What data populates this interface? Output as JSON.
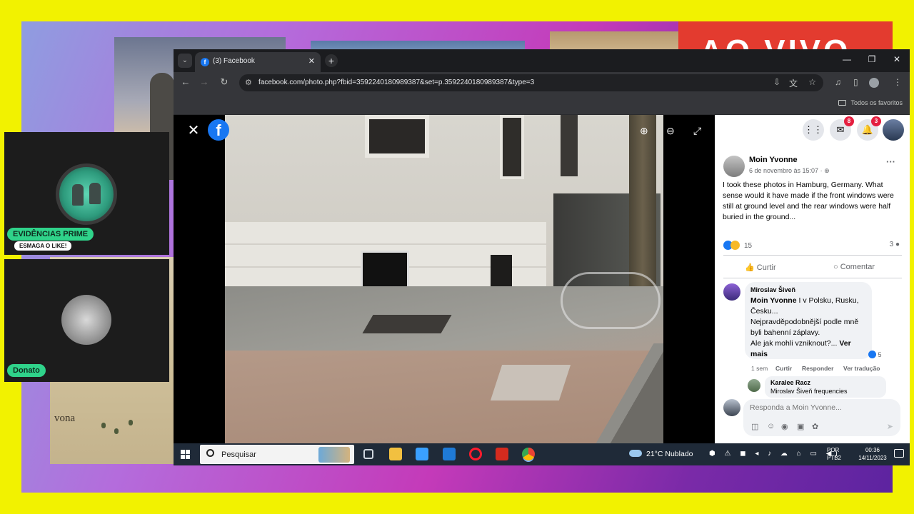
{
  "background": {
    "live_banner": "AO VIVO",
    "map_label": "vona"
  },
  "stream_cards": [
    {
      "name": "EVIDÊNCIAS PRIME",
      "sub": "ESMAGA O LIKE!"
    },
    {
      "name": "Donato",
      "sub": ""
    }
  ],
  "browser": {
    "tab_favicon": "f",
    "tab_title": "(3) Facebook",
    "tab_close": "✕",
    "new_tab": "+",
    "window_controls": [
      "—",
      "❐",
      "✕"
    ],
    "url": "facebook.com/photo.php?fbid=3592240180989387&set=p.3592240180989387&type=3",
    "bookmarks_all": "Todos os favoritos",
    "icons": {
      "back": "←",
      "forward": "→",
      "reload": "↻",
      "site_info": "⚙",
      "install": "⇩",
      "translate": "文",
      "star": "☆",
      "media": "♫",
      "sidepanel": "▯",
      "menu": "⋮",
      "tab_list": "⌄"
    }
  },
  "viewer": {
    "close": "✕",
    "logo": "f",
    "zoom_in": "⊕",
    "zoom_out": "⊖",
    "fullscreen": "⤢"
  },
  "facebook": {
    "top_icons": {
      "apps": "⋮⋮",
      "messenger": "✉",
      "notifications": "🔔"
    },
    "badges": {
      "messenger": "8",
      "notifications": "3"
    },
    "post": {
      "author": "Moin Yvonne",
      "time": "6 de novembro às 15:07 · ⊕",
      "more": "···",
      "text": "I took these photos in Hamburg, Germany. What sense would it have made if the front windows were still at ground level and the rear windows were half buried in the ground...",
      "reaction_count": "15",
      "comment_count": "3",
      "comment_icon": "●",
      "like_label": "Curtir",
      "comment_label": "Comentar",
      "like_icon": "👍",
      "comment_action_icon": "○"
    },
    "comment_1": {
      "author": "Miroslav Šiveň",
      "mention": "Moin Yvonne",
      "text": " I v Polsku, Rusku, Česku...\nNejpravděpodobnější podle mně byli bahenní záplavy.\nAle jak mohli vzniknout?... ",
      "more": "Ver mais",
      "likes": "5",
      "time": "1 sem",
      "like": "Curtir",
      "reply": "Responder",
      "translate": "Ver tradução"
    },
    "comment_2": {
      "author": "Karalee Racz",
      "text": "Miroslav Šiveň frequencies"
    },
    "reply_placeholder": "Responda a Moin Yvonne...",
    "reply_icons": [
      "◫",
      "☺",
      "◉",
      "▣",
      "✿"
    ],
    "send_icon": "➤"
  },
  "taskbar": {
    "search": "Pesquisar",
    "weather": "21°C  Nublado",
    "tray": "⬢ ⚠ ◼ ◂ ♪ ☁ ⌂ ▭ ◀)",
    "lang_1": "POR",
    "lang_2": "PTB2",
    "time": "00:36",
    "date": "14/11/2023"
  }
}
